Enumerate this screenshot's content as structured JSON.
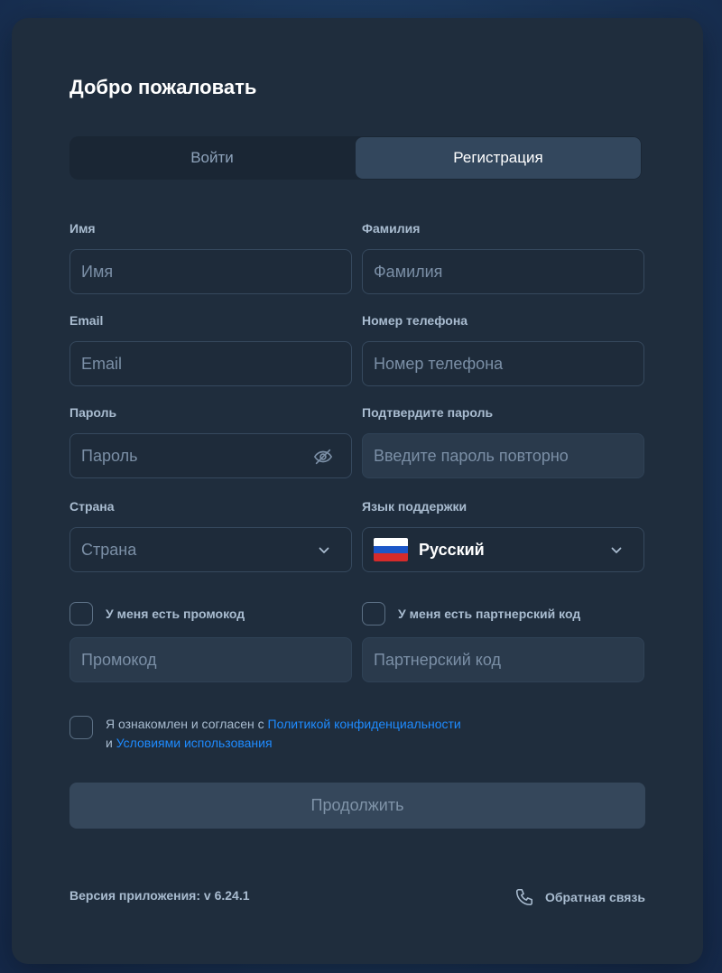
{
  "title": "Добро пожаловать",
  "tabs": [
    {
      "label": "Войти",
      "active": false
    },
    {
      "label": "Регистрация",
      "active": true
    }
  ],
  "fields": {
    "first_name": {
      "label": "Имя",
      "placeholder": "Имя"
    },
    "last_name": {
      "label": "Фамилия",
      "placeholder": "Фамилия"
    },
    "email": {
      "label": "Email",
      "placeholder": "Email"
    },
    "phone": {
      "label": "Номер телефона",
      "placeholder": "Номер телефона"
    },
    "password": {
      "label": "Пароль",
      "placeholder": "Пароль",
      "icon": "eye-off-icon"
    },
    "password_confirm": {
      "label": "Подтвердите пароль",
      "placeholder": "Введите пароль повторно"
    },
    "country": {
      "label": "Страна",
      "placeholder": "Страна",
      "icon": "chevron-down-icon"
    },
    "support_language": {
      "label": "Язык поддержки",
      "value": "Русский",
      "icon": "chevron-down-icon",
      "flag": "russia-flag-icon"
    }
  },
  "promo": {
    "checkbox_label": "У меня есть промокод",
    "checked": false,
    "placeholder": "Промокод"
  },
  "partner": {
    "checkbox_label": "У меня есть партнерский код",
    "checked": false,
    "placeholder": "Партнерский код"
  },
  "terms": {
    "checked": false,
    "text_before": "Я ознакомлен и согласен с ",
    "privacy_link": "Политикой конфиденциальности",
    "text_and": "и ",
    "terms_link": "Условиями использования"
  },
  "submit_label": "Продолжить",
  "footer": {
    "version": "Версия приложения: v 6.24.1",
    "feedback": "Обратная связь"
  },
  "colors": {
    "accent_link": "#1e8bff",
    "panel": "#1f2d3d",
    "tab_active": "#33475d",
    "button_disabled": "#35475b"
  }
}
